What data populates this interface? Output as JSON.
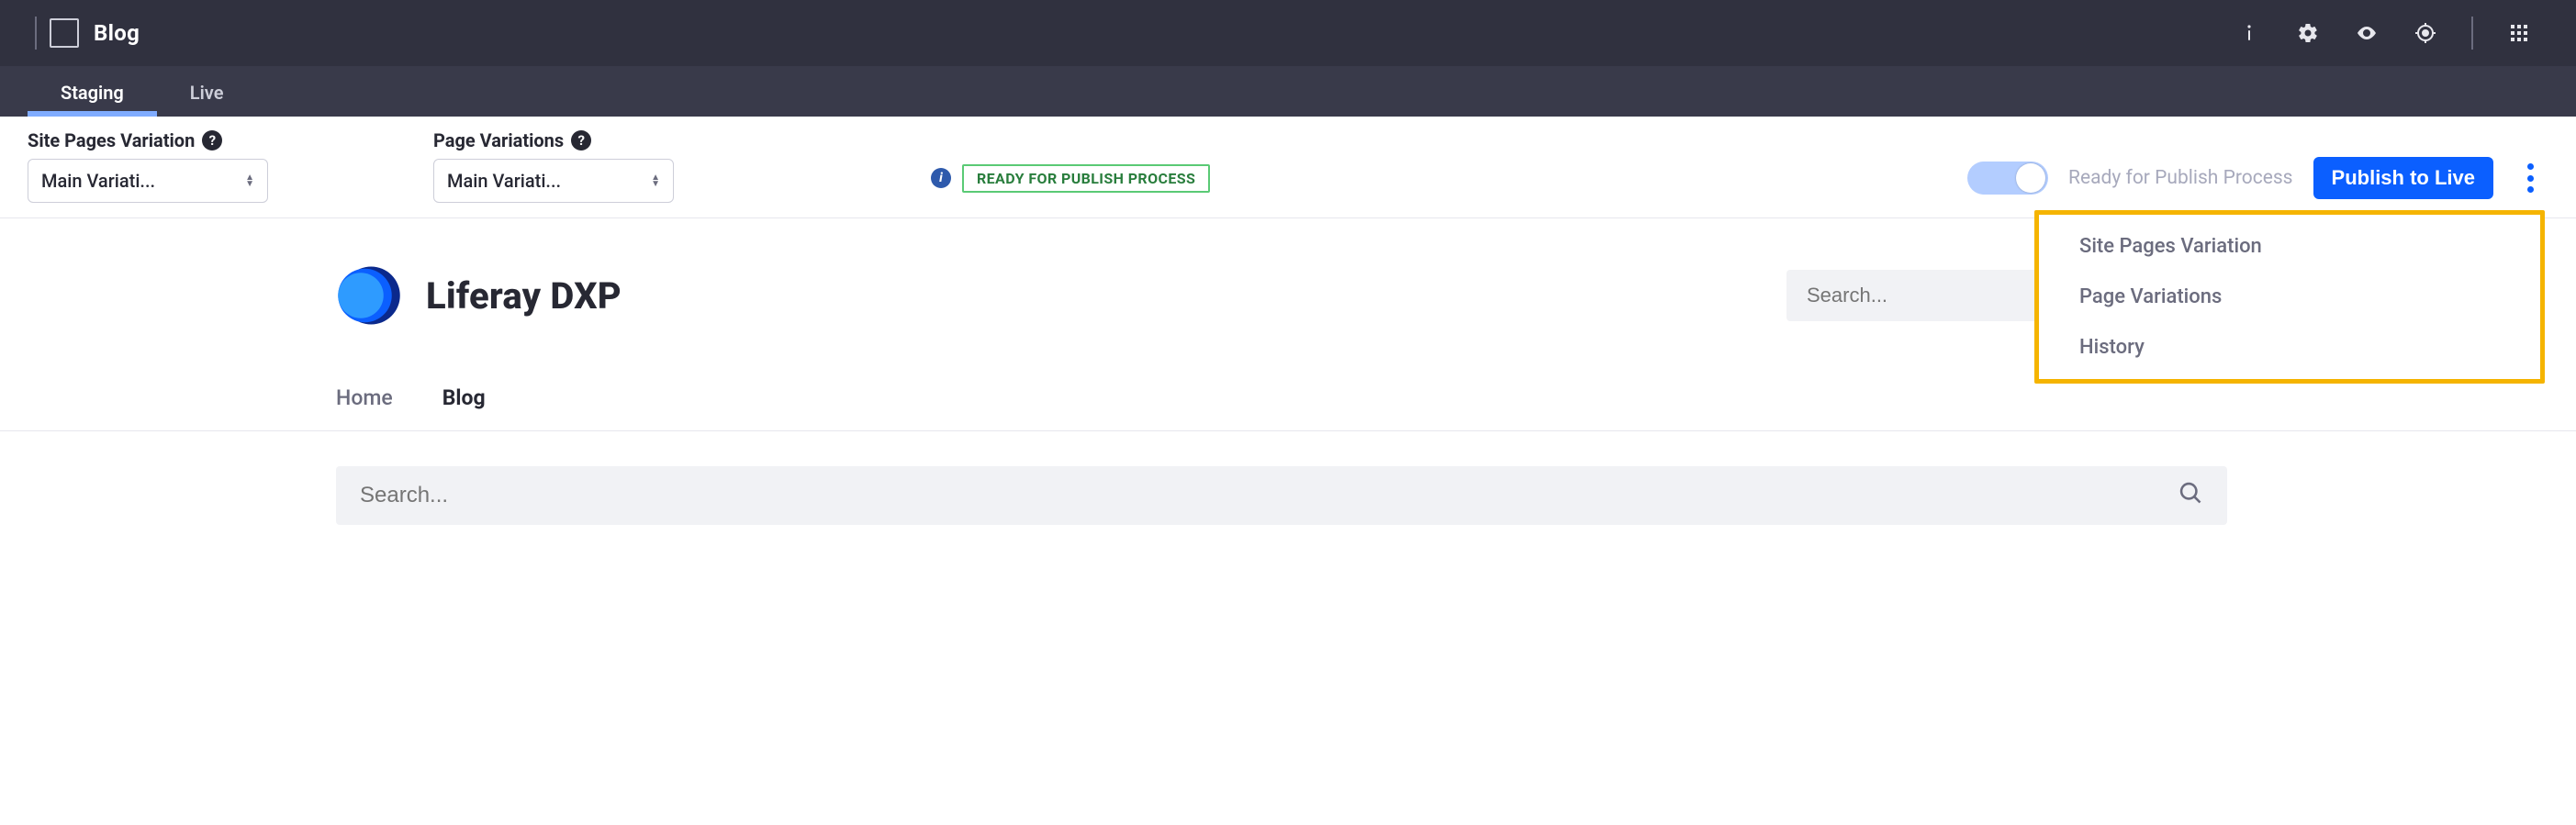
{
  "topbar": {
    "title": "Blog"
  },
  "tabs": {
    "staging": "Staging",
    "live": "Live"
  },
  "controls": {
    "site_pages_label": "Site Pages Variation",
    "site_pages_value": "Main Variati...",
    "page_variations_label": "Page Variations",
    "page_variations_value": "Main Variati...",
    "ready_badge": "READY FOR PUBLISH PROCESS",
    "ready_text": "Ready for Publish Process",
    "publish_btn": "Publish to Live"
  },
  "popover": {
    "item1": "Site Pages Variation",
    "item2": "Page Variations",
    "item3": "History"
  },
  "site": {
    "brand": "Liferay DXP",
    "search_placeholder": "Search...",
    "nav_home": "Home",
    "nav_blog": "Blog"
  },
  "page": {
    "search_placeholder": "Search..."
  }
}
